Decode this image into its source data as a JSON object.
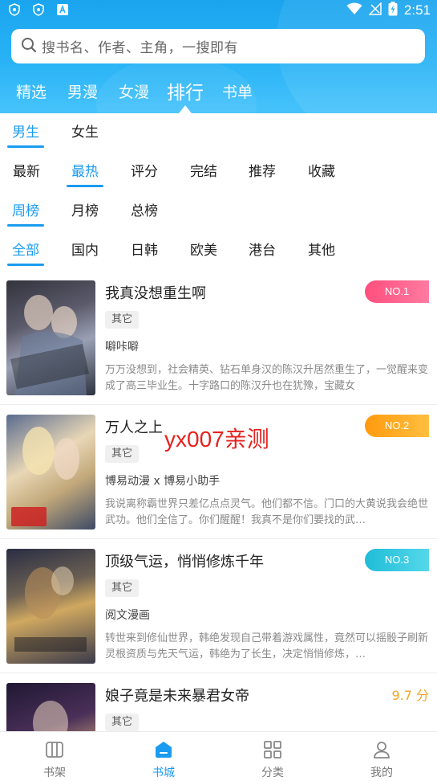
{
  "status_bar": {
    "time": "2:51"
  },
  "search": {
    "placeholder": "搜书名、作者、主角，一搜即有"
  },
  "main_tabs": [
    {
      "label": "精选",
      "active": false
    },
    {
      "label": "男漫",
      "active": false
    },
    {
      "label": "女漫",
      "active": false
    },
    {
      "label": "排行",
      "active": true
    },
    {
      "label": "书单",
      "active": false
    }
  ],
  "filters": {
    "gender": [
      {
        "label": "男生",
        "active": true
      },
      {
        "label": "女生",
        "active": false
      }
    ],
    "sort": [
      {
        "label": "最新",
        "active": false
      },
      {
        "label": "最热",
        "active": true
      },
      {
        "label": "评分",
        "active": false
      },
      {
        "label": "完结",
        "active": false
      },
      {
        "label": "推荐",
        "active": false
      },
      {
        "label": "收藏",
        "active": false
      }
    ],
    "period": [
      {
        "label": "周榜",
        "active": true
      },
      {
        "label": "月榜",
        "active": false
      },
      {
        "label": "总榜",
        "active": false
      }
    ],
    "region": [
      {
        "label": "全部",
        "active": true
      },
      {
        "label": "国内",
        "active": false
      },
      {
        "label": "日韩",
        "active": false
      },
      {
        "label": "欧美",
        "active": false
      },
      {
        "label": "港台",
        "active": false
      },
      {
        "label": "其他",
        "active": false
      }
    ]
  },
  "books": [
    {
      "title": "我真没想重生啊",
      "tag": "其它",
      "author": "噼咔噼",
      "desc": "万万没想到，社会精英、钻石单身汉的陈汉升居然重生了，一觉醒来变成了高三毕业生。十字路口的陈汉升也在犹豫，宝藏女",
      "rank": "NO.1",
      "rank_color": "#ff5a8a"
    },
    {
      "title": "万人之上",
      "tag": "其它",
      "author": "博易动漫 x 博易小助手",
      "desc": "我说离称霸世界只差亿点点灵气。他们都不信。门口的大黄说我会绝世武功。他们全信了。你们醒醒！我真不是你们要找的武…",
      "rank": "NO.2",
      "rank_color": "#ffa21f"
    },
    {
      "title": "顶级气运，悄悄修炼千年",
      "tag": "其它",
      "author": "阅文漫画",
      "desc": "转世来到修仙世界，韩绝发现自己带着游戏属性，竟然可以摇骰子刷新灵根资质与先天气运，韩绝为了长生，决定悄悄修炼，…",
      "rank": "NO.3",
      "rank_color": "#2cc3d8"
    },
    {
      "title": "娘子竟是未来暴君女帝",
      "tag": "其它",
      "score": "9.7 分"
    }
  ],
  "watermark": "yx007亲测",
  "bottom_nav": [
    {
      "label": "书架",
      "active": false,
      "icon": "bookshelf-icon"
    },
    {
      "label": "书城",
      "active": true,
      "icon": "bookstore-icon"
    },
    {
      "label": "分类",
      "active": false,
      "icon": "category-icon"
    },
    {
      "label": "我的",
      "active": false,
      "icon": "profile-icon"
    }
  ],
  "colors": {
    "accent": "#1a9bf0",
    "header": "#29b3f6"
  }
}
